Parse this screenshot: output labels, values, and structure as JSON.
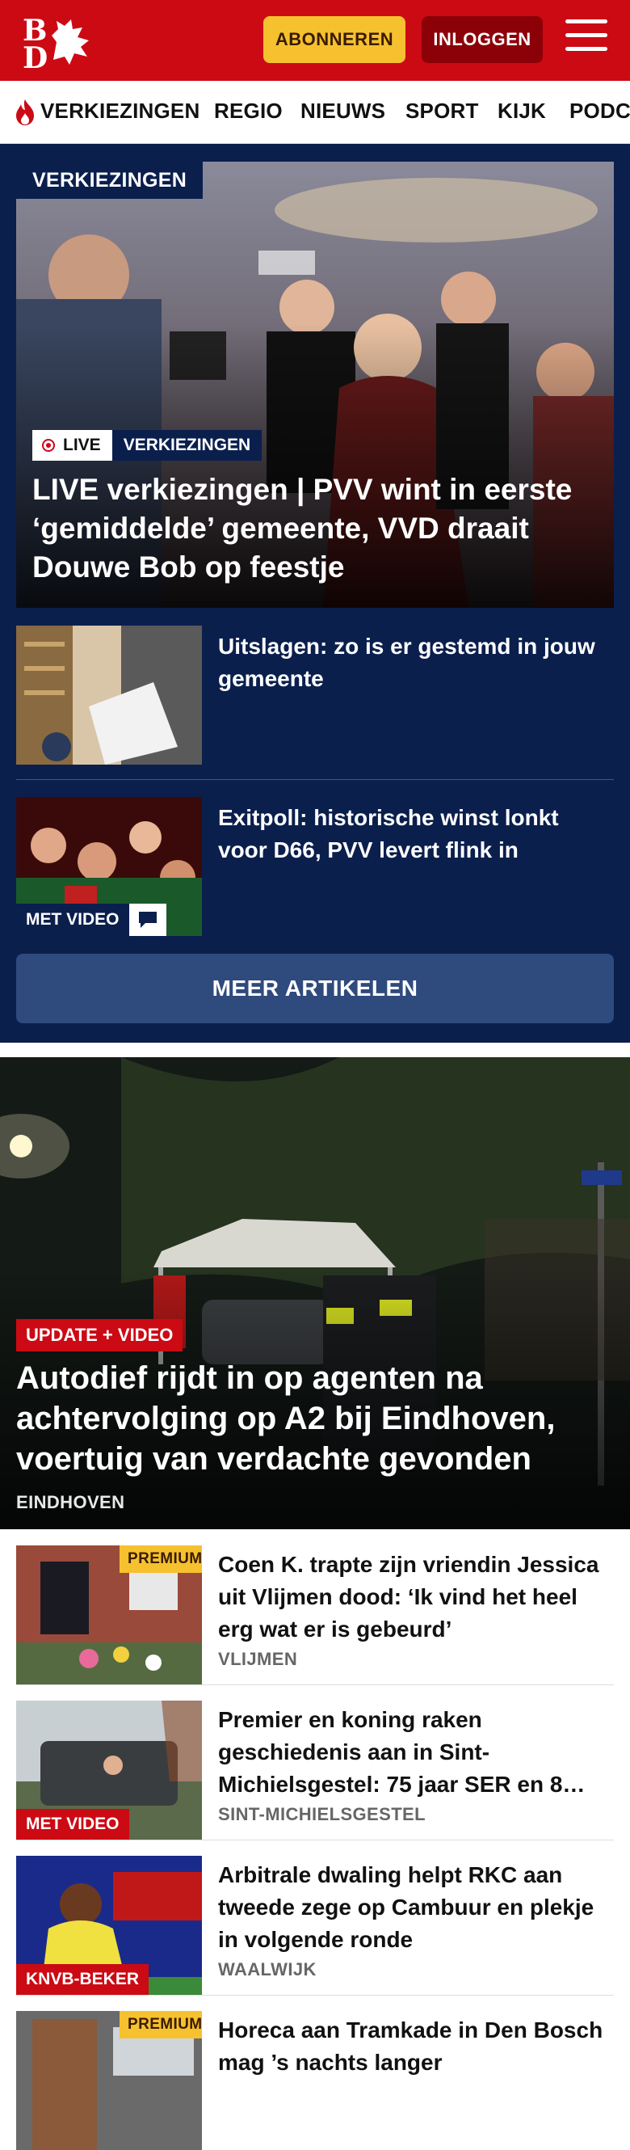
{
  "header": {
    "logo_text": "BD",
    "subscribe_label": "ABONNEREN",
    "login_label": "INLOGGEN"
  },
  "nav": {
    "items": [
      "VERKIEZINGEN",
      "REGIO",
      "NIEUWS",
      "SPORT",
      "KIJK",
      "PODC"
    ]
  },
  "election": {
    "section_label": "VERKIEZINGEN",
    "hero": {
      "live_label": "LIVE",
      "category_label": "VERKIEZINGEN",
      "title": "LIVE verkiezingen | PVV wint in eerste ‘gemiddelde’ gemeente, VVD draait Douwe Bob op feestje"
    },
    "articles": [
      {
        "title": "Uitslagen: zo is er gestemd in jouw gemeente"
      },
      {
        "title": "Exitpoll: historische winst lonkt voor D66, PVV levert flink in",
        "badge": "MET VIDEO"
      }
    ],
    "more_label": "MEER ARTIKELEN"
  },
  "featured": {
    "tag": "UPDATE + VIDEO",
    "title": "Autodief rijdt in op agenten na achtervolging op A2 bij Eindhoven, voertuig van verdachte gevonden",
    "location": "EINDHOVEN"
  },
  "list": [
    {
      "title": "Coen K. trapte zijn vriendin Jessica uit Vlijmen dood: ‘Ik vind het heel erg wat er is gebeurd’",
      "location": "VLIJMEN",
      "premium": "PREMIUM"
    },
    {
      "title": "Premier en koning raken geschiedenis aan in Sint-Michielsgestel: 75 jaar SER en 8…",
      "location": "SINT-MICHIELSGESTEL",
      "tag": "MET VIDEO"
    },
    {
      "title": "Arbitrale dwaling helpt RKC aan tweede zege op Cambuur en plekje in volgende ronde",
      "location": "WAALWIJK",
      "tag": "KNVB-BEKER"
    },
    {
      "title": "Horeca aan Tramkade in Den Bosch mag ’s nachts langer",
      "premium": "PREMIUM"
    }
  ],
  "colors": {
    "brand_red": "#cc0a14",
    "navy": "#0b1f4d",
    "premium_yellow": "#f6c12f"
  }
}
